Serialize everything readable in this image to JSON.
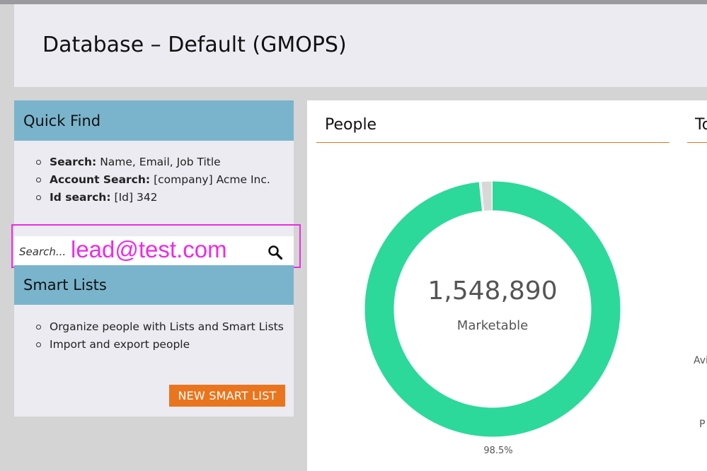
{
  "header": {
    "title": "Database – Default (GMOPS)"
  },
  "quick_find": {
    "title": "Quick Find",
    "items": [
      {
        "bold": "Search:",
        "text": "Name, Email, Job Title"
      },
      {
        "bold": "Account Search:",
        "text": "[company] Acme Inc."
      },
      {
        "bold": "Id search:",
        "text": "[Id] 342"
      }
    ],
    "search": {
      "placeholder": "Search...",
      "typed_value": "lead@test.com",
      "icon": "search-icon"
    }
  },
  "smart_lists": {
    "title": "Smart Lists",
    "items": [
      "Organize people with Lists and Smart Lists",
      "Import and export people"
    ],
    "button_label": "NEW SMART LIST"
  },
  "people_card": {
    "title": "People",
    "next_card_title_partial": "To",
    "side_label_1": "Avi",
    "side_label_2": "P",
    "donut": {
      "value": "1,548,890",
      "label": "Marketable",
      "percent_label": "98.5%",
      "marketable_fraction": 0.985,
      "colors": {
        "marketable": "#2cd99b",
        "other": "#d8d8d8"
      }
    }
  },
  "colors": {
    "accent_orange": "#e9751e",
    "panel_header_blue": "#7ab4cc",
    "highlight_magenta": "#ee2ae6"
  }
}
